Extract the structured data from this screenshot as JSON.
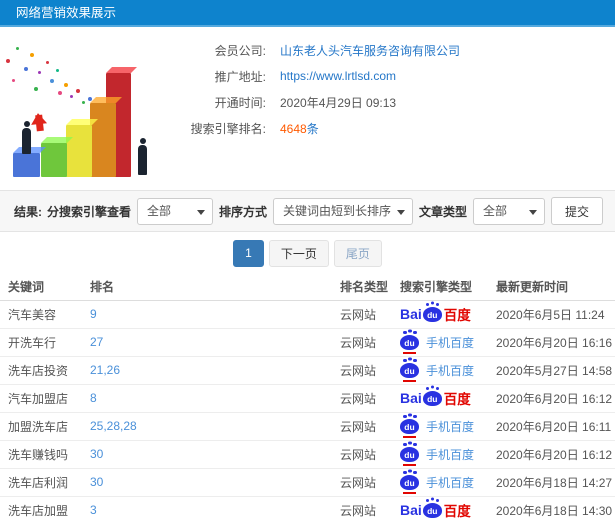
{
  "header": {
    "title": "网络营销效果展示"
  },
  "info": {
    "company_label": "会员公司:",
    "company_value": "山东老人头汽车服务咨询有限公司",
    "url_label": "推广地址:",
    "url_value": "https://www.lrtlsd.com",
    "open_time_label": "开通时间:",
    "open_time_value": "2020年4月29日 09:13",
    "ranking_label": "搜索引擎排名:",
    "ranking_count": "4648",
    "ranking_unit": "条"
  },
  "filters": {
    "result_label": "结果:",
    "engine_label": "分搜索引擎查看",
    "engine_value": "全部",
    "sort_label": "排序方式",
    "sort_value": "关键词由短到长排序",
    "article_label": "文章类型",
    "article_value": "全部",
    "submit_label": "提交"
  },
  "pagination": {
    "current": "1",
    "next": "下一页",
    "last": "尾页"
  },
  "table": {
    "headers": [
      "关键词",
      "排名",
      "排名类型",
      "搜索引擎类型",
      "最新更新时间"
    ],
    "rows": [
      {
        "keyword": "汽车美容",
        "rank": "9",
        "rank_type": "云网站",
        "engine": "baidu",
        "updated": "2020年6月5日 11:24"
      },
      {
        "keyword": "开洗车行",
        "rank": "27",
        "rank_type": "云网站",
        "engine": "shouji",
        "updated": "2020年6月20日 16:16"
      },
      {
        "keyword": "洗车店投资",
        "rank": "21,26",
        "rank_type": "云网站",
        "engine": "shouji",
        "updated": "2020年5月27日 14:58"
      },
      {
        "keyword": "汽车加盟店",
        "rank": "8",
        "rank_type": "云网站",
        "engine": "baidu",
        "updated": "2020年6月20日 16:12"
      },
      {
        "keyword": "加盟洗车店",
        "rank": "25,28,28",
        "rank_type": "云网站",
        "engine": "shouji",
        "updated": "2020年6月20日 16:11"
      },
      {
        "keyword": "洗车赚钱吗",
        "rank": "30",
        "rank_type": "云网站",
        "engine": "shouji",
        "updated": "2020年6月20日 16:12"
      },
      {
        "keyword": "洗车店利润",
        "rank": "30",
        "rank_type": "云网站",
        "engine": "shouji",
        "updated": "2020年6月18日 14:27"
      },
      {
        "keyword": "洗车店加盟",
        "rank": "3",
        "rank_type": "云网站",
        "engine": "baidu",
        "updated": "2020年6月18日 14:30"
      }
    ]
  },
  "logos": {
    "baidu_bai": "Bai",
    "baidu_du": "du",
    "baidu_cn": "百度",
    "mobile_baidu": "手机百度"
  },
  "colors": {
    "header_bg": "#0e83cd",
    "link_blue": "#2577c8",
    "rank_blue": "#4a90d9",
    "highlight_orange": "#ff5a00",
    "baidu_blue": "#2932e1",
    "baidu_red": "#e10601",
    "pagination_active": "#3779b5"
  }
}
